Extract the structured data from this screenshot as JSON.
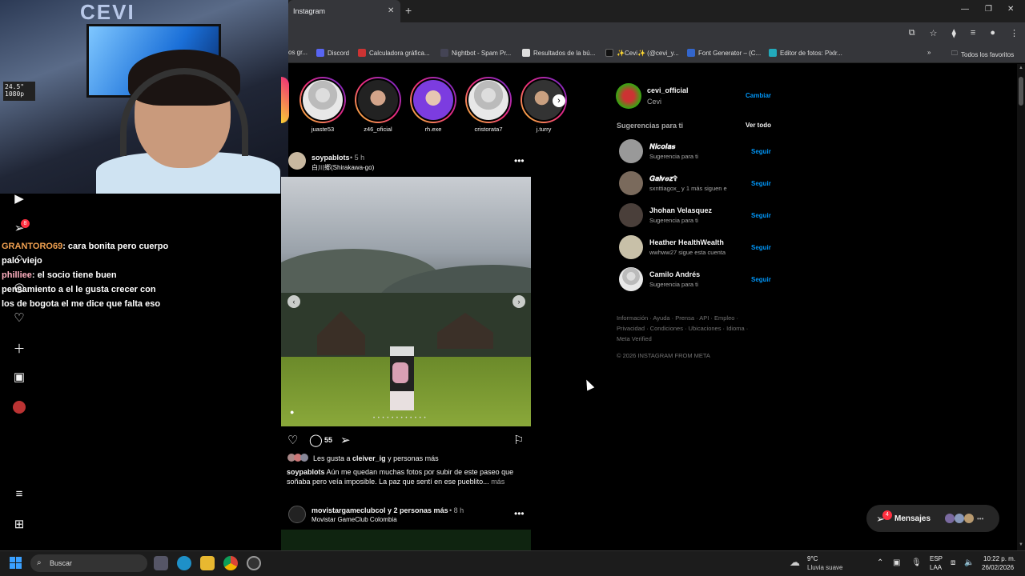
{
  "browser": {
    "tab_title": "Instagram",
    "bookmarks": [
      {
        "label": "os gr..."
      },
      {
        "label": "Discord"
      },
      {
        "label": "Calculadora gráfica..."
      },
      {
        "label": "Nightbot - Spam Pr..."
      },
      {
        "label": "Resultados de la bú..."
      },
      {
        "label": "✨Cevi✨ (@cevi_y..."
      },
      {
        "label": "Font Generator – (C..."
      },
      {
        "label": "Editor de fotos: Pixlr..."
      }
    ],
    "all_bookmarks": "Todos los favoritos"
  },
  "stream": {
    "osd": "24.5\" 1080p",
    "logo": "CEVI",
    "chat": [
      {
        "user": "GRANTORO69",
        "message": ": cara bonita pero cuerpo palo viejo"
      },
      {
        "user": "philliee",
        "message": ": el socio tiene buen pensamiento a el le gusta crecer con los de bogota el me dice que falta eso"
      }
    ],
    "notif_count": "8"
  },
  "stories": [
    {
      "name": "juaste53"
    },
    {
      "name": "z46_oficial"
    },
    {
      "name": "rh.exe"
    },
    {
      "name": "cristorata7"
    },
    {
      "name": "j.turry"
    }
  ],
  "post": {
    "author": "soypablots",
    "time": "• 5 h",
    "location": "白川郷(Shirakawa-go)",
    "dots": "• • • • • • • • • • • •",
    "comments": "55",
    "likes_prefix": "Les gusta a ",
    "likes_user": "cleiver_ig",
    "likes_suffix": " y personas más",
    "caption_user": "soypablots",
    "caption_text": " Aún me quedan muchas fotos por subir de este paseo que soñaba pero veía imposible. La paz que sentí en ese pueblito...",
    "caption_more": " más"
  },
  "post2": {
    "author": "movistargameclubcol y 2 personas más",
    "time": "• 8 h",
    "subtitle": "Movistar GameClub Colombia"
  },
  "sidebar": {
    "me_user": "cevi_official",
    "me_name": "Cevi",
    "switch": "Cambiar",
    "suggestions_title": "Sugerencias para ti",
    "see_all": "Ver todo",
    "follow": "Seguir",
    "suggestions": [
      {
        "name": "𝑵𝒊𝒄𝒐𝒍𝒂𝒔",
        "sub": "Sugerencia para ti"
      },
      {
        "name": "𝑮𝒂𝒍𝒗𝒆𝒛✞",
        "sub": "sxnttiagox_ y 1 más siguen e"
      },
      {
        "name": "Jhohan Velasquez",
        "sub": "Sugerencia para ti"
      },
      {
        "name": "Heather HealthWealth",
        "sub": "wwhww27 sigue esta cuenta"
      },
      {
        "name": "Camilo Andrés",
        "sub": "Sugerencia para ti"
      }
    ],
    "footer_line1": "Información · Ayuda · Prensa · API · Empleo ·",
    "footer_line2": "Privacidad · Condiciones · Ubicaciones · Idioma ·",
    "footer_line3": "Meta Verified",
    "copyright": "© 2026 INSTAGRAM FROM META"
  },
  "messages": {
    "label": "Mensajes",
    "badge": "4"
  },
  "taskbar": {
    "search_placeholder": "Buscar",
    "weather_temp": "9°C",
    "weather_desc": "Lluvia suave",
    "lang1": "ESP",
    "lang2": "LAA",
    "time": "10:22 p. m.",
    "date": "26/02/2026"
  },
  "colors": {
    "accent": "#0095f6",
    "badge": "#ff3040",
    "background": "#000000"
  }
}
